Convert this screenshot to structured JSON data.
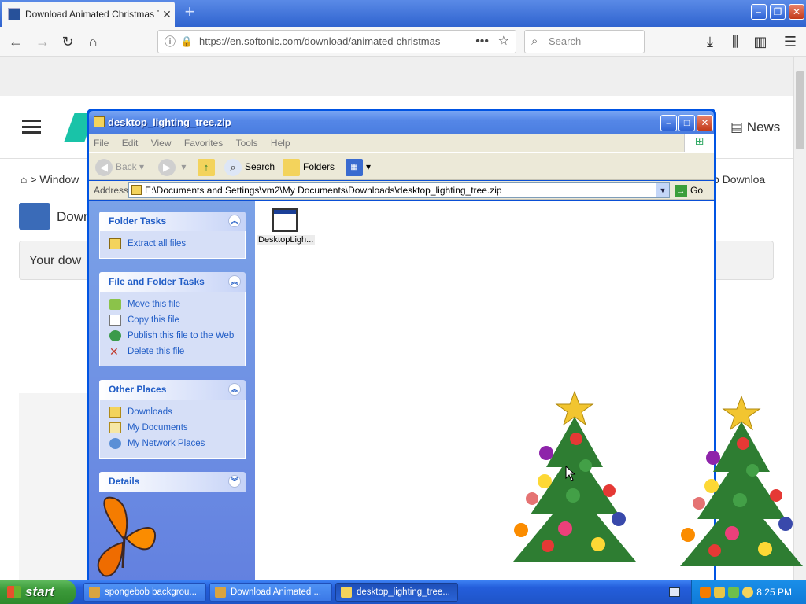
{
  "browser": {
    "tab": {
      "title": "Download Animated Christmas Tre",
      "close": "✕"
    },
    "new_tab": "+",
    "url_text": "https://en.softonic.com/download/animated-christmas",
    "search_placeholder": "Search",
    "window_buttons": {
      "minimize": "–",
      "restore": "❐",
      "close": "✕"
    }
  },
  "page": {
    "news_label": "News",
    "breadcrumb": "> Window",
    "breadcrumb_right": "p Downloa",
    "app_name": "Down",
    "banner": "Your dow"
  },
  "explorer": {
    "title": "desktop_lighting_tree.zip",
    "menu": [
      "File",
      "Edit",
      "View",
      "Favorites",
      "Tools",
      "Help"
    ],
    "toolbar": {
      "back": "Back",
      "search": "Search",
      "folders": "Folders"
    },
    "address_label": "Address",
    "address_value": "E:\\Documents and Settings\\vm2\\My Documents\\Downloads\\desktop_lighting_tree.zip",
    "go_label": "Go",
    "panels": {
      "folder_tasks": {
        "title": "Folder Tasks",
        "items": [
          "Extract all files"
        ]
      },
      "file_folder_tasks": {
        "title": "File and Folder Tasks",
        "items": [
          "Move this file",
          "Copy this file",
          "Publish this file to the Web",
          "Delete this file"
        ]
      },
      "other_places": {
        "title": "Other Places",
        "items": [
          "Downloads",
          "My Documents",
          "My Network Places"
        ]
      },
      "details": {
        "title": "Details"
      }
    },
    "file": {
      "name": "DesktopLigh..."
    }
  },
  "taskbar": {
    "start_label": "start",
    "tasks": [
      "spongebob backgrou...",
      "Download Animated ...",
      "desktop_lighting_tree..."
    ],
    "clock": "8:25 PM"
  },
  "colors": {
    "xp_blue": "#0054e3",
    "start_green": "#3c9a3a",
    "tray_blue": "#0f7ad8",
    "task_link": "#215dc6"
  }
}
